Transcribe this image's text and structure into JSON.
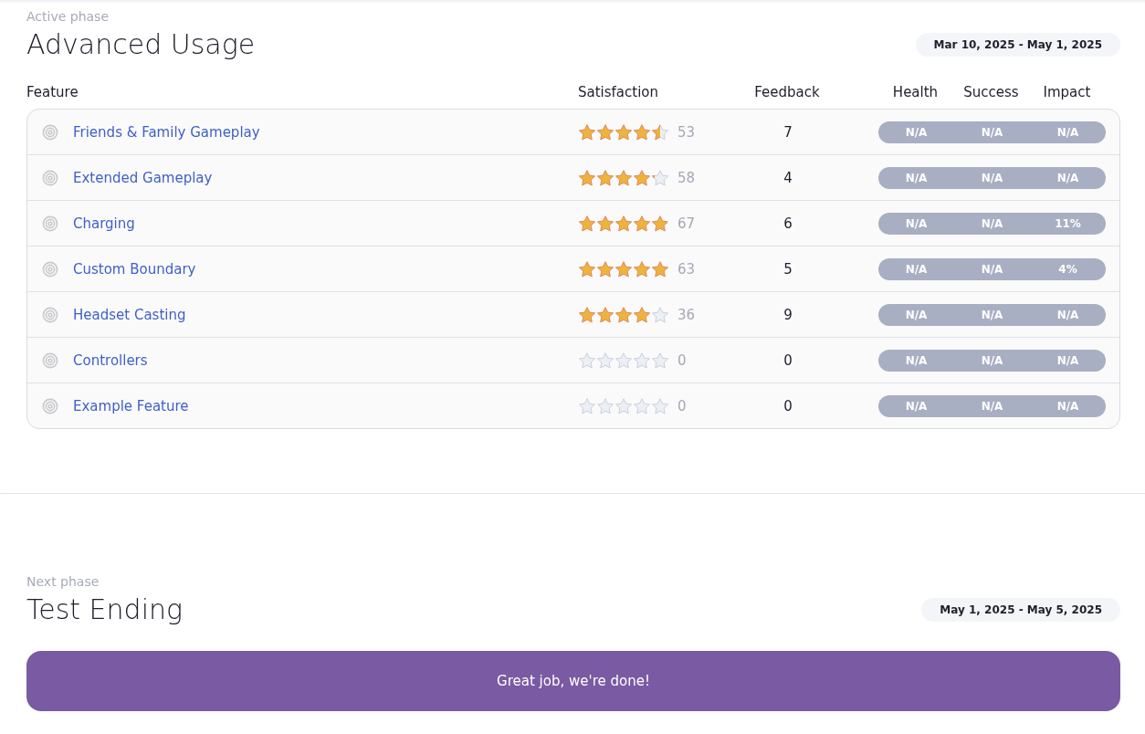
{
  "active_phase": {
    "label": "Active phase",
    "title": "Advanced Usage",
    "date_range": "Mar 10, 2025 - May 1, 2025"
  },
  "table": {
    "columns": [
      "Feature",
      "Satisfaction",
      "Feedback",
      "Health",
      "Success",
      "Impact"
    ],
    "rows": [
      {
        "name": "Friends & Family Gameplay",
        "stars": 4.5,
        "ratings": "53",
        "feedback": "7",
        "health": "N/A",
        "success": "N/A",
        "impact": "N/A"
      },
      {
        "name": "Extended Gameplay",
        "stars": 4.2,
        "ratings": "58",
        "feedback": "4",
        "health": "N/A",
        "success": "N/A",
        "impact": "N/A"
      },
      {
        "name": "Charging",
        "stars": 4.9,
        "ratings": "67",
        "feedback": "6",
        "health": "N/A",
        "success": "N/A",
        "impact": "11%"
      },
      {
        "name": "Custom Boundary",
        "stars": 5,
        "ratings": "63",
        "feedback": "5",
        "health": "N/A",
        "success": "N/A",
        "impact": "4%"
      },
      {
        "name": "Headset Casting",
        "stars": 4,
        "ratings": "36",
        "feedback": "9",
        "health": "N/A",
        "success": "N/A",
        "impact": "N/A"
      },
      {
        "name": "Controllers",
        "stars": 0,
        "ratings": "0",
        "feedback": "0",
        "health": "N/A",
        "success": "N/A",
        "impact": "N/A"
      },
      {
        "name": "Example Feature",
        "stars": 0,
        "ratings": "0",
        "feedback": "0",
        "health": "N/A",
        "success": "N/A",
        "impact": "N/A"
      }
    ]
  },
  "next_phase": {
    "label": "Next phase",
    "title": "Test Ending",
    "date_range": "May 1, 2025 - May 5, 2025"
  },
  "banner": {
    "text": "Great job, we're done!"
  }
}
